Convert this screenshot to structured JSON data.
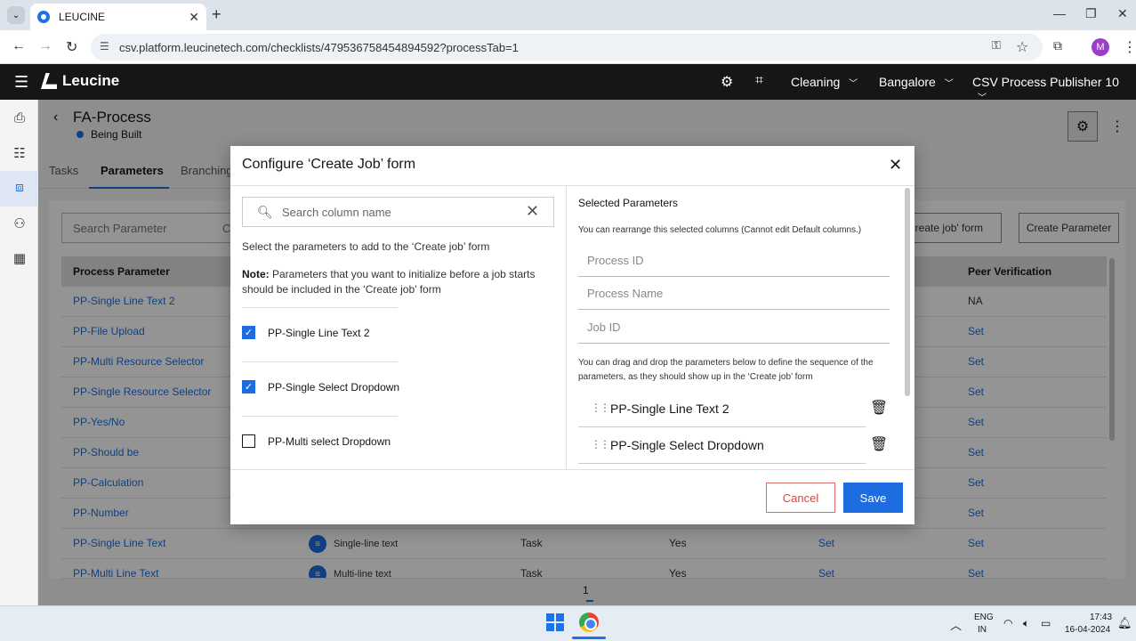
{
  "browser": {
    "tab_title": "LEUCINE",
    "url": "csv.platform.leucinetech.com/checklists/479536758454894592?processTab=1",
    "profile_initial": "M"
  },
  "app": {
    "brand": "Leucine",
    "facility": "Cleaning",
    "site": "Bangalore",
    "user": "CSV Process Publisher 10"
  },
  "process": {
    "title": "FA-Process",
    "status": "Being Built",
    "tabs": [
      "Tasks",
      "Parameters",
      "Branching"
    ]
  },
  "toolbar": {
    "search_placeholder": "Search Parameter",
    "search_trail": "C",
    "configure_btn": "reate job' form",
    "create_btn": "Create Parameter"
  },
  "table": {
    "col_process_parameter": "Process Parameter",
    "col_peer_verification": "Peer Verification",
    "rows": [
      {
        "name": "PP-Single Line Text 2",
        "peer": "NA"
      },
      {
        "name": "PP-File Upload",
        "peer": "Set"
      },
      {
        "name": "PP-Multi Resource Selector",
        "peer": "Set"
      },
      {
        "name": "PP-Single Resource Selector",
        "peer": "Set"
      },
      {
        "name": "PP-Yes/No",
        "peer": "Set"
      },
      {
        "name": "PP-Should be",
        "peer": "Set"
      },
      {
        "name": "PP-Calculation",
        "peer": "Set"
      },
      {
        "name": "PP-Number",
        "peer": "Set"
      },
      {
        "name": "PP-Single Line Text",
        "type": "Single-line text",
        "target": "Task",
        "mandatory": "Yes",
        "verification": "Set",
        "peer": "Set"
      },
      {
        "name": "PP-Multi Line Text",
        "type": "Multi-line text",
        "target": "Task",
        "mandatory": "Yes",
        "verification": "Set",
        "peer": "Set"
      }
    ],
    "page": "1"
  },
  "modal": {
    "title": "Configure ‘Create Job’ form",
    "search_placeholder": "Search column name",
    "desc": "Select the parameters to add to the ‘Create job’ form",
    "note_label": "Note:",
    "note_text": " Parameters that you want to initialize before a job starts should be included in the ‘Create job’ form",
    "options": [
      {
        "label": "PP-Single Line Text 2",
        "checked": true
      },
      {
        "label": "PP-Single Select Dropdown",
        "checked": true
      },
      {
        "label": "PP-Multi select Dropdown",
        "checked": false
      }
    ],
    "selected_title": "Selected Parameters",
    "selected_sub": "You can rearrange this selected columns (Cannot edit Default columns.)",
    "default_fields": [
      "Process ID",
      "Process Name",
      "Job ID"
    ],
    "drag_hint": "You can drag and drop the parameters below to define the sequence of the parameters, as they should show up in the ‘Create job’ form",
    "selected": [
      "PP-Single Line Text 2",
      "PP-Single Select Dropdown"
    ],
    "cancel": "Cancel",
    "save": "Save"
  },
  "taskbar": {
    "lang1": "ENG",
    "lang2": "IN",
    "time": "17:43",
    "date": "16-04-2024"
  },
  "colors": {
    "primary": "#1d6de0",
    "header_bg": "#161616",
    "cancel_red": "#e04040"
  }
}
